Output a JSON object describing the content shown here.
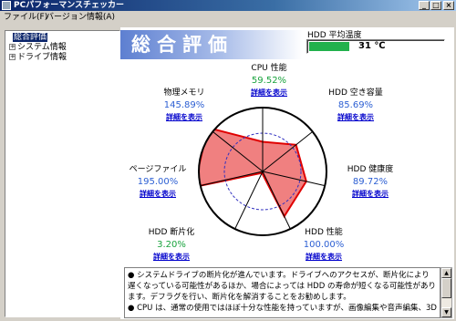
{
  "window": {
    "title": "PCパフォーマンスチェッカー",
    "buttons": [
      "_",
      "□",
      "×"
    ]
  },
  "menubar": {
    "items": [
      "ファイル(F)",
      "バージョン情報(A)"
    ]
  },
  "tree": {
    "items": [
      {
        "label": "総合評価",
        "expander": "",
        "selected": true
      },
      {
        "label": "システム情報",
        "expander": "+",
        "selected": false
      },
      {
        "label": "ドライブ情報",
        "expander": "+",
        "selected": false
      }
    ]
  },
  "main": {
    "banner_title": "総合評価",
    "hdd_temp": {
      "label": "HDD 平均温度",
      "value": "31 ℃",
      "fill_fraction": 0.3
    },
    "link_text": "詳細を表示",
    "metrics": [
      {
        "key": "cpu",
        "name": "CPU 性能",
        "value": "59.52%",
        "score": 59.52,
        "status": "good"
      },
      {
        "key": "hdd_space",
        "name": "HDD 空き容量",
        "value": "85.69%",
        "score": 85.69,
        "status": "normal"
      },
      {
        "key": "hdd_health",
        "name": "HDD 健康度",
        "value": "89.72%",
        "score": 89.72,
        "status": "normal"
      },
      {
        "key": "hdd_perf",
        "name": "HDD 性能",
        "value": "100.00%",
        "score": 100.0,
        "status": "normal"
      },
      {
        "key": "hdd_frag",
        "name": "HDD 断片化",
        "value": "3.20%",
        "score": 3.2,
        "status": "good"
      },
      {
        "key": "pagefile",
        "name": "ページファイル",
        "value": "195.00%",
        "score": 195.0,
        "status": "normal"
      },
      {
        "key": "phys_mem",
        "name": "物理メモリ",
        "value": "145.89%",
        "score": 145.89,
        "status": "normal"
      }
    ],
    "message": {
      "lines": [
        "● システムドライブの断片化が進んでいます。ドライブへのアクセスが、断片化により遅くなっている可能性があるほか、場合によっては HDD の寿命が短くなる可能性があります。デフラグを行い、断片化を解消することをお勧めします。",
        "● CPU は、通常の使用ではほぼ十分な性能を持っていますが、画像編集や音声編集、3D"
      ]
    },
    "radar_colors": {
      "fill": "#f08080",
      "stroke": "#e00000",
      "grid": "#000000",
      "inner_ring": "#3030c0"
    }
  }
}
